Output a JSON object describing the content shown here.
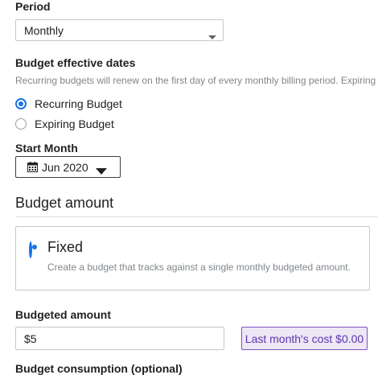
{
  "period": {
    "label": "Period",
    "selected": "Monthly"
  },
  "effective_dates": {
    "label": "Budget effective dates",
    "help": "Recurring budgets will renew on the first day of every monthly billing period. Expiring",
    "options": [
      {
        "label": "Recurring Budget",
        "checked": true
      },
      {
        "label": "Expiring Budget",
        "checked": false
      }
    ]
  },
  "start_month": {
    "label": "Start Month",
    "value": "Jun 2020"
  },
  "budget_amount": {
    "title": "Budget amount",
    "fixed_label": "Fixed",
    "fixed_help": "Create a budget that tracks against a single monthly budgeted amount."
  },
  "budgeted_amount": {
    "label": "Budgeted amount",
    "value": "$5",
    "last_month_button": "Last month's cost $0.00"
  },
  "next_section": {
    "title": "Budget consumption (optional)"
  },
  "colors": {
    "accent": "#1a73e8",
    "suggestion_bg": "#ede7f6",
    "suggestion_text": "#5e35b1"
  }
}
